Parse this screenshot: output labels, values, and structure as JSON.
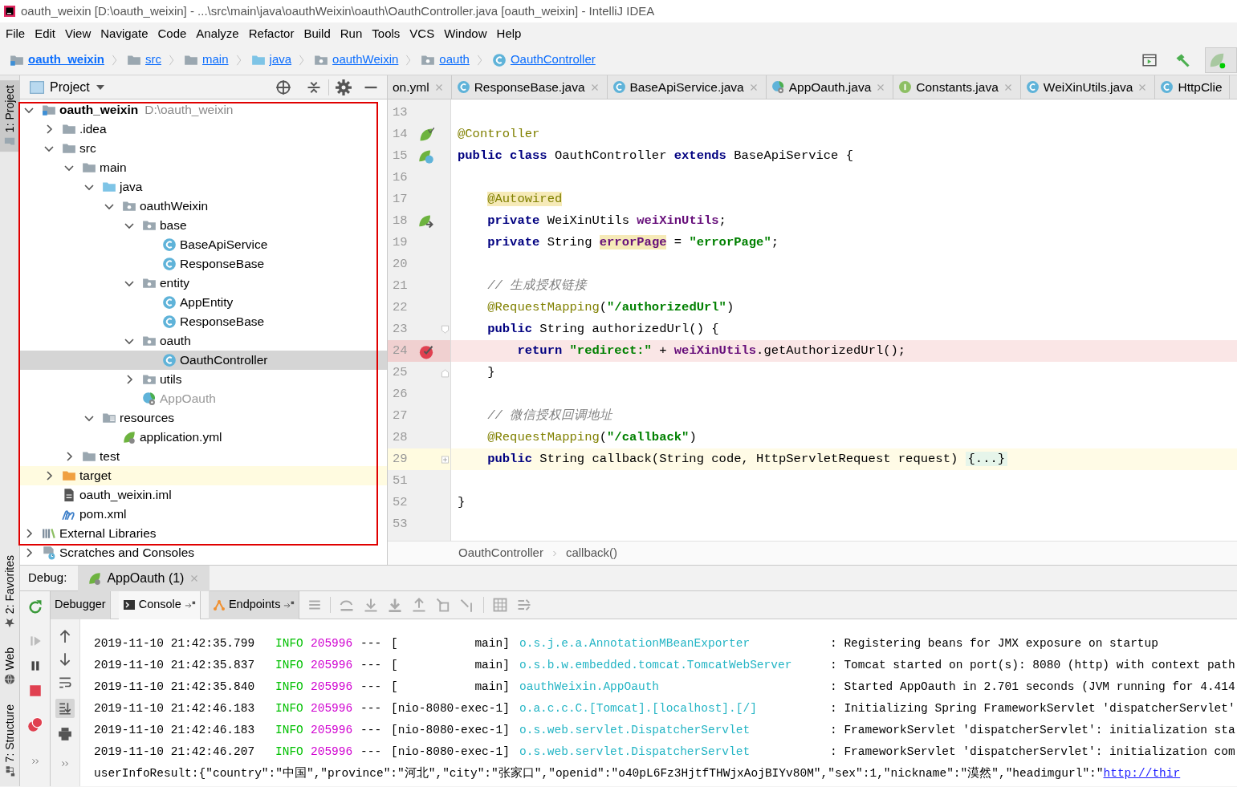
{
  "window": {
    "title": "oauth_weixin [D:\\oauth_weixin] - ...\\src\\main\\java\\oauthWeixin\\oauth\\OauthController.java [oauth_weixin] - IntelliJ IDEA"
  },
  "menu": [
    "File",
    "Edit",
    "View",
    "Navigate",
    "Code",
    "Analyze",
    "Refactor",
    "Build",
    "Run",
    "Tools",
    "VCS",
    "Window",
    "Help"
  ],
  "breadcrumbs": [
    {
      "label": "oauth_weixin",
      "kind": "module"
    },
    {
      "label": "src",
      "kind": "folder"
    },
    {
      "label": "main",
      "kind": "folder"
    },
    {
      "label": "java",
      "kind": "source"
    },
    {
      "label": "oauthWeixin",
      "kind": "package"
    },
    {
      "label": "oauth",
      "kind": "package"
    },
    {
      "label": "OauthController",
      "kind": "class"
    }
  ],
  "tool_stripe": [
    {
      "label": "1: Project",
      "kind": "folder",
      "selected": true
    },
    {
      "label": "2: Favorites",
      "kind": "star",
      "selected": false
    },
    {
      "label": "Web",
      "kind": "globe",
      "selected": false
    },
    {
      "label": "7: Structure",
      "kind": "structure",
      "selected": false
    }
  ],
  "project_panel": {
    "title": "Project",
    "tree": [
      {
        "label": "oauth_weixin",
        "hint": "D:\\oauth_weixin",
        "kind": "module",
        "expanded": true,
        "selected": false,
        "children": [
          {
            "label": ".idea",
            "kind": "folder",
            "expanded": false,
            "selected": false
          },
          {
            "label": "src",
            "kind": "folder",
            "expanded": true,
            "selected": false,
            "children": [
              {
                "label": "main",
                "kind": "folder",
                "expanded": true,
                "selected": false,
                "children": [
                  {
                    "label": "java",
                    "kind": "source",
                    "expanded": true,
                    "selected": false,
                    "children": [
                      {
                        "label": "oauthWeixin",
                        "kind": "package",
                        "expanded": true,
                        "selected": false,
                        "children": [
                          {
                            "label": "base",
                            "kind": "package",
                            "expanded": true,
                            "selected": false,
                            "children": [
                              {
                                "label": "BaseApiService",
                                "kind": "class",
                                "selected": false
                              },
                              {
                                "label": "ResponseBase",
                                "kind": "class",
                                "selected": false
                              }
                            ]
                          },
                          {
                            "label": "entity",
                            "kind": "package",
                            "expanded": true,
                            "selected": false,
                            "children": [
                              {
                                "label": "AppEntity",
                                "kind": "class",
                                "selected": false
                              },
                              {
                                "label": "ResponseBase",
                                "kind": "class",
                                "selected": false
                              }
                            ]
                          },
                          {
                            "label": "oauth",
                            "kind": "package",
                            "expanded": true,
                            "selected": false,
                            "children": [
                              {
                                "label": "OauthController",
                                "kind": "class",
                                "selected": true
                              }
                            ]
                          },
                          {
                            "label": "utils",
                            "kind": "package",
                            "expanded": false,
                            "selected": false
                          },
                          {
                            "label": "AppOauth",
                            "kind": "spring-app",
                            "selected": false
                          }
                        ]
                      }
                    ]
                  },
                  {
                    "label": "resources",
                    "kind": "resources",
                    "expanded": true,
                    "selected": false,
                    "children": [
                      {
                        "label": "application.yml",
                        "kind": "yml",
                        "selected": false
                      }
                    ]
                  }
                ]
              },
              {
                "label": "test",
                "kind": "folder",
                "expanded": false,
                "selected": false
              }
            ]
          },
          {
            "label": "target",
            "kind": "excluded",
            "expanded": false,
            "selected": false
          },
          {
            "label": "oauth_weixin.iml",
            "kind": "iml",
            "selected": false
          },
          {
            "label": "pom.xml",
            "kind": "maven",
            "selected": false
          }
        ]
      },
      {
        "label": "External Libraries",
        "kind": "library",
        "expanded": false,
        "selected": false
      },
      {
        "label": "Scratches and Consoles",
        "kind": "scratches",
        "expanded": false,
        "selected": false
      }
    ]
  },
  "editor_tabs": [
    {
      "label": "on.yml",
      "closable": true,
      "selected": false
    },
    {
      "label": "ResponseBase.java",
      "kind": "class",
      "closable": true,
      "selected": false
    },
    {
      "label": "BaseApiService.java",
      "kind": "class",
      "closable": true,
      "selected": false
    },
    {
      "label": "AppOauth.java",
      "kind": "spring-app",
      "closable": true,
      "selected": false
    },
    {
      "label": "Constants.java",
      "kind": "interface",
      "closable": true,
      "selected": false
    },
    {
      "label": "WeiXinUtils.java",
      "kind": "class",
      "closable": true,
      "selected": false
    },
    {
      "label": "HttpClie",
      "kind": "class",
      "closable": false,
      "selected": false
    }
  ],
  "code": [
    {
      "number": "13"
    },
    {
      "number": "14",
      "gutter_icon": {
        "kind": "bean"
      },
      "tokens": [
        {
          "kind": "ann",
          "text": "@Controller"
        }
      ]
    },
    {
      "number": "15",
      "gutter_icon": {
        "kind": "bean-class"
      },
      "tokens": [
        {
          "kind": "kw",
          "text": "public class "
        },
        {
          "kind": "plain",
          "text": "OauthController "
        },
        {
          "kind": "kw",
          "text": "extends "
        },
        {
          "kind": "plain",
          "text": "BaseApiService {"
        }
      ]
    },
    {
      "number": "16"
    },
    {
      "number": "17",
      "tokens": [
        {
          "kind": "ann-hl",
          "text": "    @Autowired"
        }
      ]
    },
    {
      "number": "18",
      "gutter_icon": {
        "kind": "autowired"
      },
      "tokens": [
        {
          "kind": "kw",
          "text": "    private "
        },
        {
          "kind": "plain",
          "text": "WeiXinUtils "
        },
        {
          "kind": "field",
          "text": "weiXinUtils"
        },
        {
          "kind": "plain",
          "text": ";"
        }
      ]
    },
    {
      "number": "19",
      "tokens": [
        {
          "kind": "kw",
          "text": "    private "
        },
        {
          "kind": "plain",
          "text": "String "
        },
        {
          "kind": "field-hl",
          "text": "errorPage"
        },
        {
          "kind": "plain",
          "text": " = "
        },
        {
          "kind": "str",
          "text": "\"errorPage\""
        },
        {
          "kind": "plain",
          "text": ";"
        }
      ]
    },
    {
      "number": "20"
    },
    {
      "number": "21",
      "tokens": [
        {
          "kind": "comment",
          "text": "    // 生成授权链接"
        }
      ]
    },
    {
      "number": "22",
      "tokens": [
        {
          "kind": "ann",
          "text": "    @RequestMapping"
        },
        {
          "kind": "plain",
          "text": "("
        },
        {
          "kind": "str",
          "text": "\"/authorizedUrl\""
        },
        {
          "kind": "plain",
          "text": ")"
        }
      ]
    },
    {
      "number": "23",
      "fold_marker": {
        "kind": "start"
      },
      "tokens": [
        {
          "kind": "kw",
          "text": "    public "
        },
        {
          "kind": "plain",
          "text": "String authorizedUrl() {"
        }
      ]
    },
    {
      "number": "24",
      "kind": "breakpoint",
      "gutter_icon": {
        "kind": "breakpoint"
      },
      "tokens": [
        {
          "kind": "kw",
          "text": "        return "
        },
        {
          "kind": "str",
          "text": "\"redirect:\""
        },
        {
          "kind": "plain",
          "text": " + "
        },
        {
          "kind": "field",
          "text": "weiXinUtils"
        },
        {
          "kind": "plain",
          "text": ".getAuthorizedUrl();"
        }
      ]
    },
    {
      "number": "25",
      "fold_marker": {
        "kind": "end"
      },
      "tokens": [
        {
          "kind": "plain",
          "text": "    }"
        }
      ]
    },
    {
      "number": "26"
    },
    {
      "number": "27",
      "tokens": [
        {
          "kind": "comment",
          "text": "    // 微信授权回调地址"
        }
      ]
    },
    {
      "number": "28",
      "tokens": [
        {
          "kind": "ann",
          "text": "    @RequestMapping"
        },
        {
          "kind": "plain",
          "text": "("
        },
        {
          "kind": "str",
          "text": "\"/callback\""
        },
        {
          "kind": "plain",
          "text": ")"
        }
      ]
    },
    {
      "number": "29",
      "kind": "caret",
      "fold_marker": {
        "kind": "folded"
      },
      "tokens": [
        {
          "kind": "kw",
          "text": "    public "
        },
        {
          "kind": "plain",
          "text": "String callback(String code, HttpServletRequest request) "
        },
        {
          "kind": "fold",
          "text": "{...}"
        }
      ]
    },
    {
      "number": "51"
    },
    {
      "number": "52",
      "tokens": [
        {
          "kind": "plain",
          "text": "}"
        }
      ]
    },
    {
      "number": "53"
    }
  ],
  "editor_breadcrumbs": [
    "OauthController",
    "callback()"
  ],
  "debug": {
    "label": "Debug:",
    "session_tab": {
      "label": "AppOauth (1)",
      "selected": true
    },
    "tabs": [
      {
        "label": "Debugger",
        "selected": false
      },
      {
        "label": "Console",
        "kind": "console",
        "selected": true
      },
      {
        "label": "Endpoints",
        "kind": "endpoints",
        "selected": false
      }
    ],
    "console": [
      [
        {
          "kind": "time",
          "text": "2019-11-10 21:42:35.799"
        },
        {
          "kind": "level",
          "text": "INFO"
        },
        {
          "kind": "pid",
          "text": "205996"
        },
        {
          "kind": "sep",
          "text": "---"
        },
        {
          "kind": "thread",
          "text": "[           main]"
        },
        {
          "kind": "logger",
          "text": "o.s.j.e.a.AnnotationMBeanExporter"
        },
        {
          "kind": "msg",
          "text": ": Registering beans for JMX exposure on startup"
        }
      ],
      [
        {
          "kind": "time",
          "text": "2019-11-10 21:42:35.837"
        },
        {
          "kind": "level",
          "text": "INFO"
        },
        {
          "kind": "pid",
          "text": "205996"
        },
        {
          "kind": "sep",
          "text": "---"
        },
        {
          "kind": "thread",
          "text": "[           main]"
        },
        {
          "kind": "logger",
          "text": "o.s.b.w.embedded.tomcat.TomcatWebServer"
        },
        {
          "kind": "msg",
          "text": ": Tomcat started on port(s): 8080 (http) with context path"
        }
      ],
      [
        {
          "kind": "time",
          "text": "2019-11-10 21:42:35.840"
        },
        {
          "kind": "level",
          "text": "INFO"
        },
        {
          "kind": "pid",
          "text": "205996"
        },
        {
          "kind": "sep",
          "text": "---"
        },
        {
          "kind": "thread",
          "text": "[           main]"
        },
        {
          "kind": "logger",
          "text": "oauthWeixin.AppOauth"
        },
        {
          "kind": "msg",
          "text": ": Started AppOauth in 2.701 seconds (JVM running for 4.414"
        }
      ],
      [
        {
          "kind": "time",
          "text": "2019-11-10 21:42:46.183"
        },
        {
          "kind": "level",
          "text": "INFO"
        },
        {
          "kind": "pid",
          "text": "205996"
        },
        {
          "kind": "sep",
          "text": "---"
        },
        {
          "kind": "thread",
          "text": "[nio-8080-exec-1]"
        },
        {
          "kind": "logger",
          "text": "o.a.c.c.C.[Tomcat].[localhost].[/]"
        },
        {
          "kind": "msg",
          "text": ": Initializing Spring FrameworkServlet 'dispatcherServlet'"
        }
      ],
      [
        {
          "kind": "time",
          "text": "2019-11-10 21:42:46.183"
        },
        {
          "kind": "level",
          "text": "INFO"
        },
        {
          "kind": "pid",
          "text": "205996"
        },
        {
          "kind": "sep",
          "text": "---"
        },
        {
          "kind": "thread",
          "text": "[nio-8080-exec-1]"
        },
        {
          "kind": "logger",
          "text": "o.s.web.servlet.DispatcherServlet"
        },
        {
          "kind": "msg",
          "text": ": FrameworkServlet 'dispatcherServlet': initialization sta"
        }
      ],
      [
        {
          "kind": "time",
          "text": "2019-11-10 21:42:46.207"
        },
        {
          "kind": "level",
          "text": "INFO"
        },
        {
          "kind": "pid",
          "text": "205996"
        },
        {
          "kind": "sep",
          "text": "---"
        },
        {
          "kind": "thread",
          "text": "[nio-8080-exec-1]"
        },
        {
          "kind": "logger",
          "text": "o.s.web.servlet.DispatcherServlet"
        },
        {
          "kind": "msg",
          "text": ": FrameworkServlet 'dispatcherServlet': initialization com"
        }
      ],
      [
        {
          "kind": "text",
          "text": "userInfoResult:{\"country\":\"中国\",\"province\":\"河北\",\"city\":\"张家口\",\"openid\":\"o40pL6Fz3HjtfTHWjxAojBIYv80M\",\"sex\":1,\"nickname\":\"漠然\",\"headimgurl\":\""
        },
        {
          "kind": "link",
          "text": "http://thir"
        }
      ]
    ]
  }
}
